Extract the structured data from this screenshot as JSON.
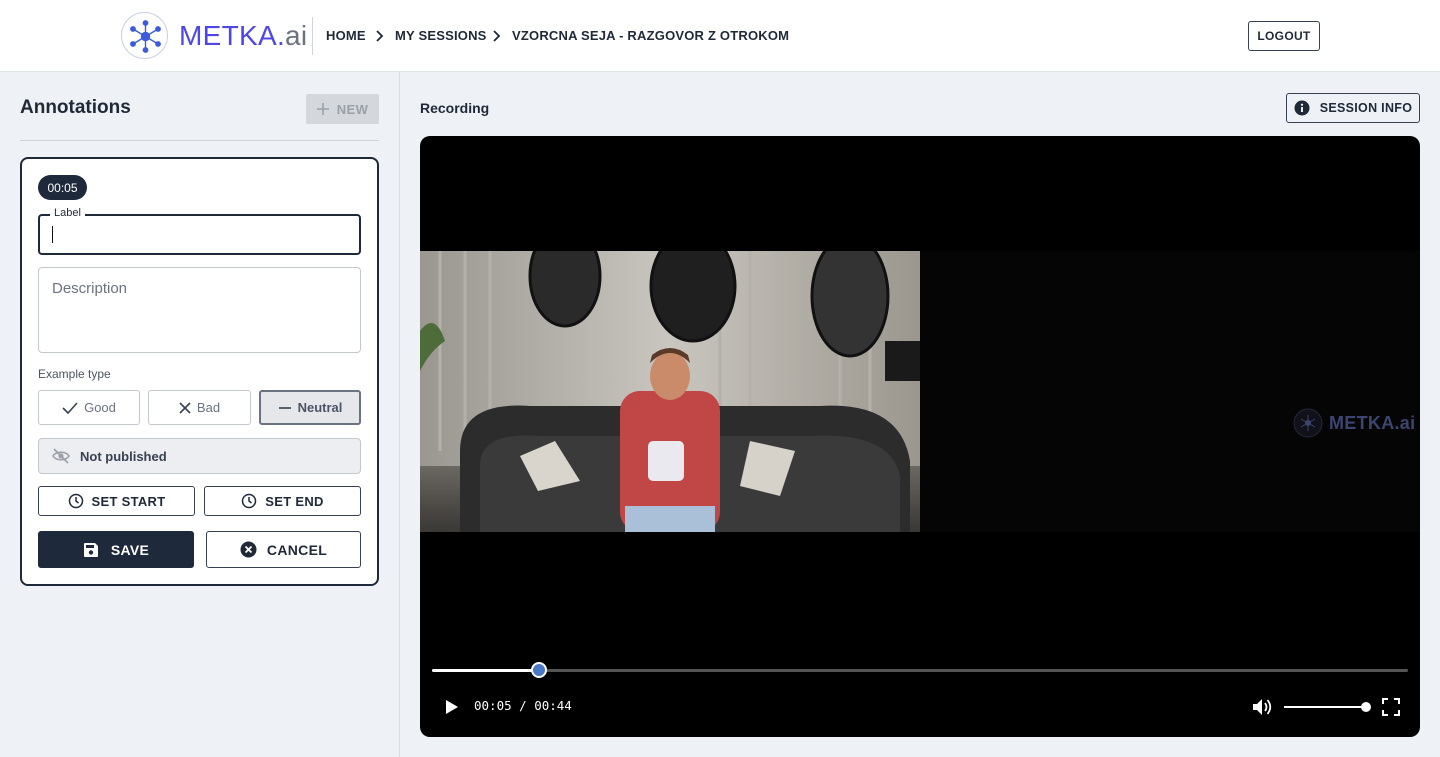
{
  "header": {
    "logo_main": "METKA.",
    "logo_suffix": "ai",
    "breadcrumbs": [
      "HOME",
      "MY SESSIONS",
      "VZORCNA SEJA - RAZGOVOR Z OTROKOM"
    ],
    "logout_label": "LOGOUT"
  },
  "annotations": {
    "title": "Annotations",
    "new_label": "NEW",
    "time_chip": "00:05",
    "label_field": {
      "legend": "Label",
      "value": ""
    },
    "description_field": {
      "placeholder": "Description",
      "value": ""
    },
    "example_type_label": "Example type",
    "example_types": [
      "Good",
      "Bad",
      "Neutral"
    ],
    "selected_type": "Neutral",
    "publish_status": "Not published",
    "set_start_label": "SET START",
    "set_end_label": "SET END",
    "save_label": "SAVE",
    "cancel_label": "CANCEL"
  },
  "recording": {
    "title": "Recording",
    "session_info_label": "SESSION INFO",
    "watermark": "METKA.ai",
    "current_time": "00:05",
    "duration": "00:44",
    "time_display": "00:05 / 00:44",
    "progress_fraction": 0.11,
    "volume_fraction": 1.0
  },
  "colors": {
    "brand": "#4f46e5",
    "dark": "#1e293b",
    "page_bg": "#eef1f6",
    "progress_thumb": "#4a78c2"
  }
}
